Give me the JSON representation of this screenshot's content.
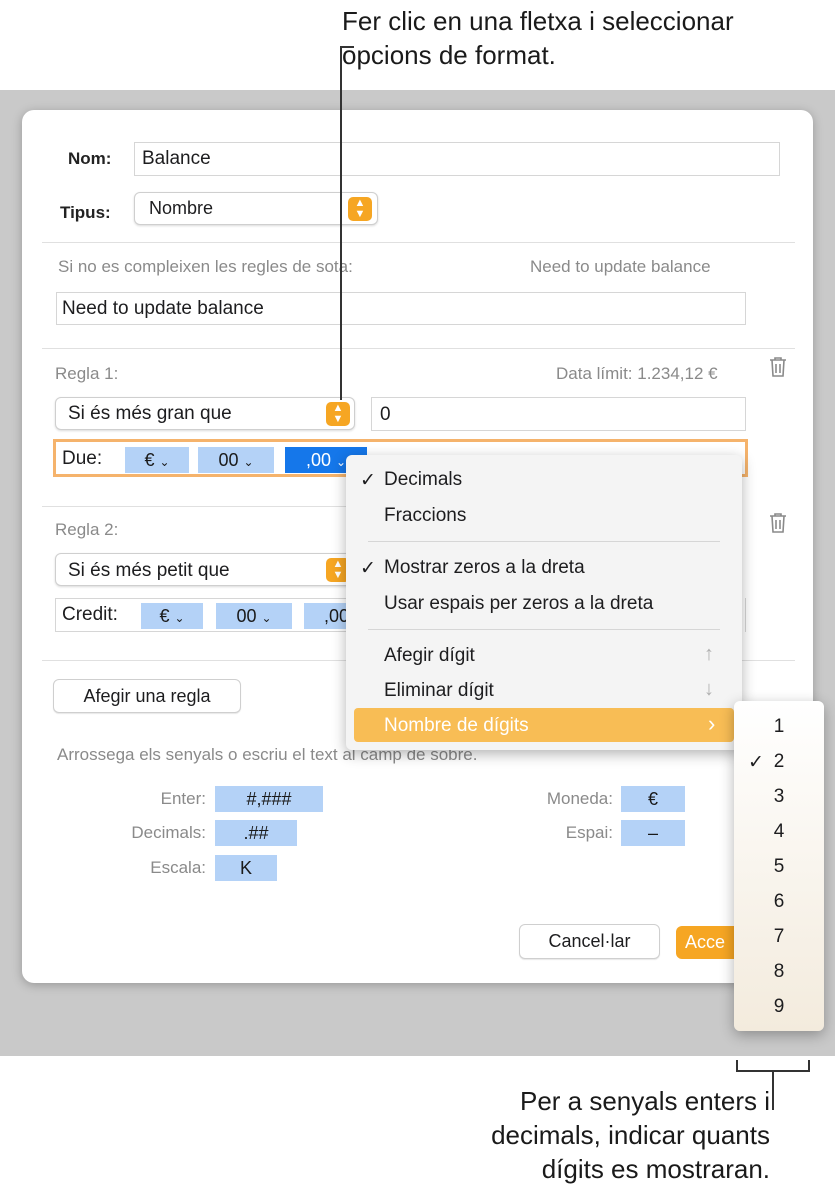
{
  "callouts": {
    "top_line1": "Fer clic en una fletxa i seleccionar",
    "top_line2": "opcions de format.",
    "bottom_line1": "Per a senyals enters i",
    "bottom_line2": "decimals, indicar quants",
    "bottom_line3": "dígits es mostraran."
  },
  "form": {
    "name_label": "Nom:",
    "name_value": "Balance",
    "type_label": "Tipus:",
    "type_value": "Nombre",
    "default_label": "Si no es compleixen les regles de sota:",
    "default_preview": "Need to update balance",
    "default_value": "Need to update balance"
  },
  "rule1": {
    "title": "Regla 1:",
    "preview": "Data límit: 1.234,12 €",
    "condition": "Si és més gran que",
    "value": "0",
    "text_label": "Due:",
    "token_currency": "€",
    "token_integer": "00",
    "token_decimal": ",00"
  },
  "rule2": {
    "title": "Regla 2:",
    "condition": "Si és més petit que",
    "text_label": "Credit:",
    "token_currency": "€",
    "token_integer": "00",
    "token_decimal": ",00"
  },
  "add_rule_button": "Afegir una regla",
  "hint": "Arrossega els senyals o escriu el text al camp de sobre.",
  "tokens": {
    "integer_label": "Enter:",
    "integer_token": "#,###",
    "decimals_label": "Decimals:",
    "decimals_token": ".##",
    "scale_label": "Escala:",
    "scale_token": "K",
    "currency_label": "Moneda:",
    "currency_token": "€",
    "space_label": "Espai:",
    "space_token": "–"
  },
  "buttons": {
    "cancel": "Cancel·lar",
    "accept": "Acce"
  },
  "menu": {
    "decimals": "Decimals",
    "fractions": "Fraccions",
    "show_zeros": "Mostrar zeros a la dreta",
    "space_zeros": "Usar espais per zeros a la dreta",
    "add_digit": "Afegir dígit",
    "remove_digit": "Eliminar dígit",
    "num_digits": "Nombre de dígits",
    "checkmark": "✓"
  },
  "submenu": {
    "options": [
      "1",
      "2",
      "3",
      "4",
      "5",
      "6",
      "7",
      "8",
      "9"
    ],
    "selected": "2"
  },
  "colors": {
    "accent": "#f6a623",
    "token": "#b4d2f7",
    "token_selected": "#1577ea",
    "menu_highlight": "#f8bd55",
    "focus_ring": "#f5b36c"
  }
}
